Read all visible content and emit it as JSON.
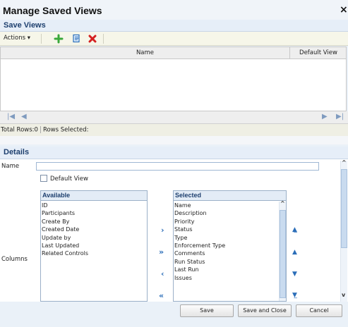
{
  "window": {
    "title": "Manage Saved Views",
    "close": "×"
  },
  "save_views": {
    "title": "Save Views",
    "toolbar": {
      "actions_label": "Actions ▾"
    },
    "grid": {
      "columns": [
        "Name",
        "Default View"
      ]
    },
    "status": {
      "total_rows": "Total Rows:0",
      "rows_selected": "Rows Selected:"
    }
  },
  "details": {
    "title": "Details",
    "name_label": "Name",
    "name_value": "",
    "default_view_label": "Default View",
    "columns_label": "Columns",
    "available": {
      "header": "Available",
      "items": [
        "ID",
        "Participants",
        "Create By",
        "Created Date",
        "Update by",
        "Last Updated",
        "Related Controls"
      ]
    },
    "selected": {
      "header": "Selected",
      "items": [
        "Name",
        "Description",
        "Priority",
        "Status",
        "Type",
        "Enforcement Type",
        "Comments",
        "Run Status",
        "Last Run",
        "Issues"
      ]
    }
  },
  "footer": {
    "save": "Save",
    "save_and_close": "Save and Close",
    "cancel": "Cancel"
  },
  "colors": {
    "accent": "#1d3f6e",
    "arrow": "#2a6db8",
    "add": "#3aa83a",
    "delete": "#d42020"
  },
  "icons": [
    "add-icon",
    "copy-icon",
    "delete-icon",
    "first-page-icon",
    "prev-page-icon",
    "next-page-icon",
    "last-page-icon",
    "move-right-icon",
    "move-all-right-icon",
    "move-left-icon",
    "move-all-left-icon",
    "move-top-icon",
    "move-up-icon",
    "move-down-icon",
    "move-bottom-icon"
  ]
}
